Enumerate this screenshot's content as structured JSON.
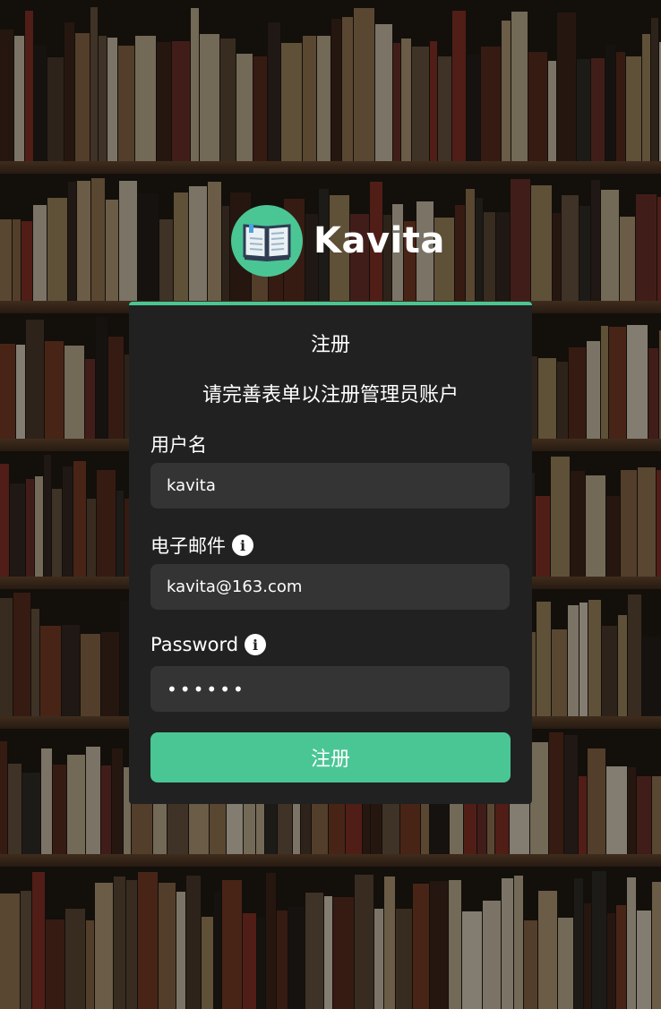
{
  "app": {
    "name": "Kavita"
  },
  "form": {
    "title": "注册",
    "subtitle": "请完善表单以注册管理员账户",
    "username": {
      "label": "用户名",
      "value": "kavita"
    },
    "email": {
      "label": "电子邮件",
      "value": "kavita@163.com",
      "info_icon": "info-icon"
    },
    "password": {
      "label": "Password",
      "value": "••••••",
      "info_icon": "info-icon"
    },
    "submit_label": "注册"
  },
  "colors": {
    "accent": "#4ac694",
    "card": "#212121",
    "input": "#343434"
  }
}
